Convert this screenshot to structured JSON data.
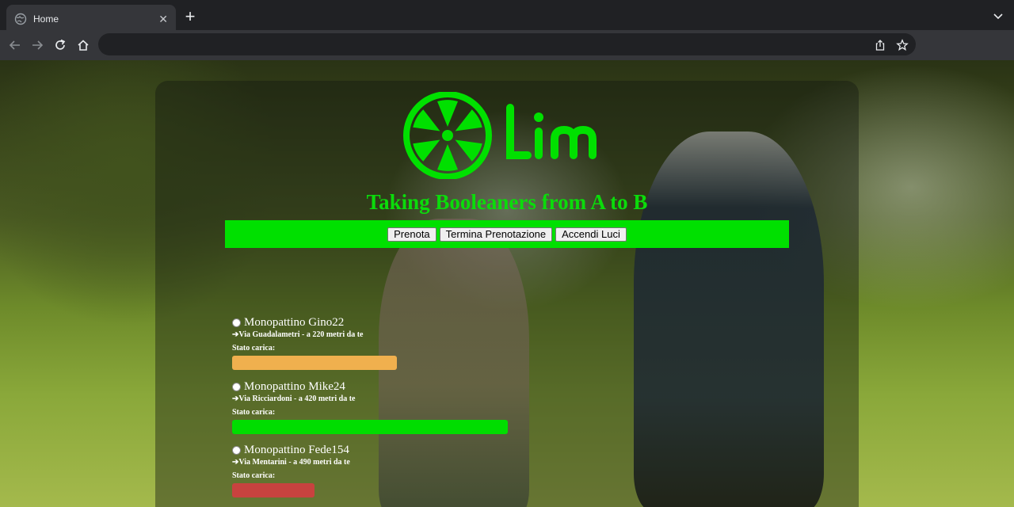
{
  "browser": {
    "tab_title": "Home",
    "new_tab_label": "+",
    "close_label": "✕",
    "address": ""
  },
  "app": {
    "logo_text": "Lim",
    "tagline": "Taking Booleaners from A to B",
    "actions": {
      "book": "Prenota",
      "end_booking": "Termina Prenotazione",
      "lights_on": "Accendi Luci"
    },
    "scooters": [
      {
        "name": "Monopattino Gino22",
        "address": "➔Via Guadalametri - a 220 metri da te",
        "charge_label": "Stato carica:",
        "charge_level": 0.52,
        "charge_color": "#f0b04e"
      },
      {
        "name": "Monopattino Mike24",
        "address": "➔Via Ricciardoni - a 420 metri da te",
        "charge_label": "Stato carica:",
        "charge_level": 0.87,
        "charge_color": "#00dd00"
      },
      {
        "name": "Monopattino Fede154",
        "address": "➔Via Mentarini - a 490 metri da te",
        "charge_label": "Stato carica:",
        "charge_level": 0.26,
        "charge_color": "#c8423f"
      }
    ]
  },
  "colors": {
    "brand": "#00e000",
    "tagline": "#0bdc0b"
  }
}
